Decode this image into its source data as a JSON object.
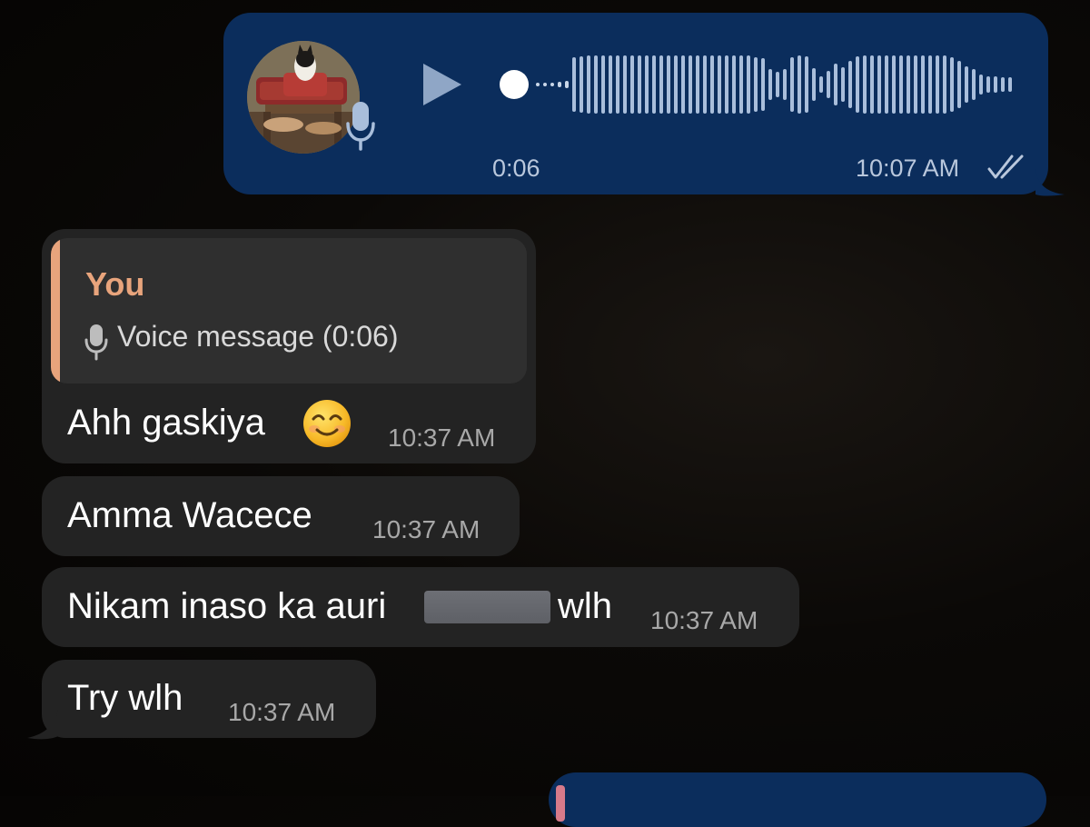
{
  "outgoing_voice": {
    "duration": "0:06",
    "time": "10:07 AM",
    "status_icon": "double-check-icon"
  },
  "incoming": [
    {
      "reply": {
        "sender": "You",
        "preview": "Voice message (0:06)",
        "icon": "mic-icon"
      },
      "text": "Ahh gaskiya",
      "emoji": "smiling-face-emoji",
      "time": "10:37 AM"
    },
    {
      "text": "Amma Wacece",
      "time": "10:37 AM"
    },
    {
      "text_before": "Nikam inaso ka auri",
      "text_after": "wlh",
      "time": "10:37 AM"
    },
    {
      "text": "Try wlh",
      "time": "10:37 AM"
    }
  ],
  "colors": {
    "outgoing_bubble": "#0b2d5c",
    "incoming_bubble": "#232323",
    "reply_accent": "#e8a47c",
    "next_reply_accent": "#d77a8a"
  }
}
